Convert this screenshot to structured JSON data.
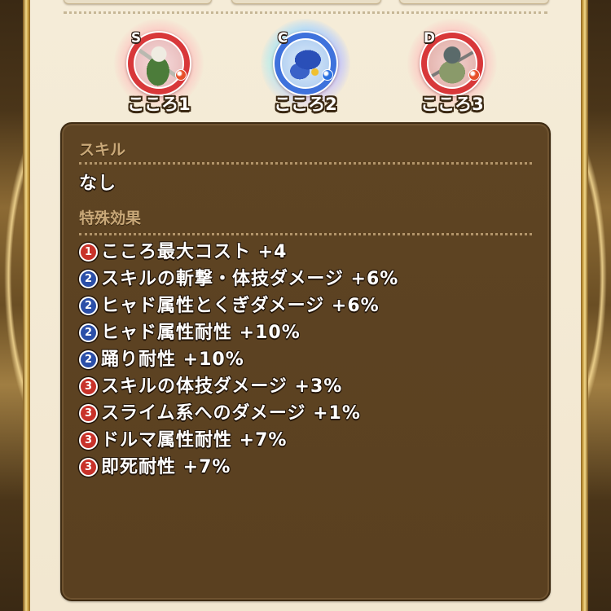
{
  "hearts": [
    {
      "label": "こころ1",
      "rank": "S",
      "ring_color": "#d8383a",
      "glow_color": "#ffbcbc",
      "gem_color": "#e8502a"
    },
    {
      "label": "こころ2",
      "rank": "C",
      "ring_color": "#3f72dc",
      "glow_color": "#b8dcff",
      "gem_color": "#2a70e0"
    },
    {
      "label": "こころ3",
      "rank": "D",
      "ring_color": "#d8383a",
      "glow_color": "#ffbcbc",
      "gem_color": "#e8502a"
    }
  ],
  "skill": {
    "header": "スキル",
    "value": "なし"
  },
  "effects": {
    "header": "特殊効果",
    "items": [
      {
        "num": "1",
        "badge_color": "#c8322a",
        "text": "こころ最大コスト +4"
      },
      {
        "num": "2",
        "badge_color": "#2b4fa8",
        "text": "スキルの斬撃・体技ダメージ +6%"
      },
      {
        "num": "2",
        "badge_color": "#2b4fa8",
        "text": "ヒャド属性とくぎダメージ +6%"
      },
      {
        "num": "2",
        "badge_color": "#2b4fa8",
        "text": "ヒャド属性耐性 +10%"
      },
      {
        "num": "2",
        "badge_color": "#2b4fa8",
        "text": "踊り耐性 +10%"
      },
      {
        "num": "3",
        "badge_color": "#c8322a",
        "text": "スキルの体技ダメージ +3%"
      },
      {
        "num": "3",
        "badge_color": "#c8322a",
        "text": "スライム系へのダメージ +1%"
      },
      {
        "num": "3",
        "badge_color": "#c8322a",
        "text": "ドルマ属性耐性 +7%"
      },
      {
        "num": "3",
        "badge_color": "#c8322a",
        "text": "即死耐性 +7%"
      }
    ]
  }
}
